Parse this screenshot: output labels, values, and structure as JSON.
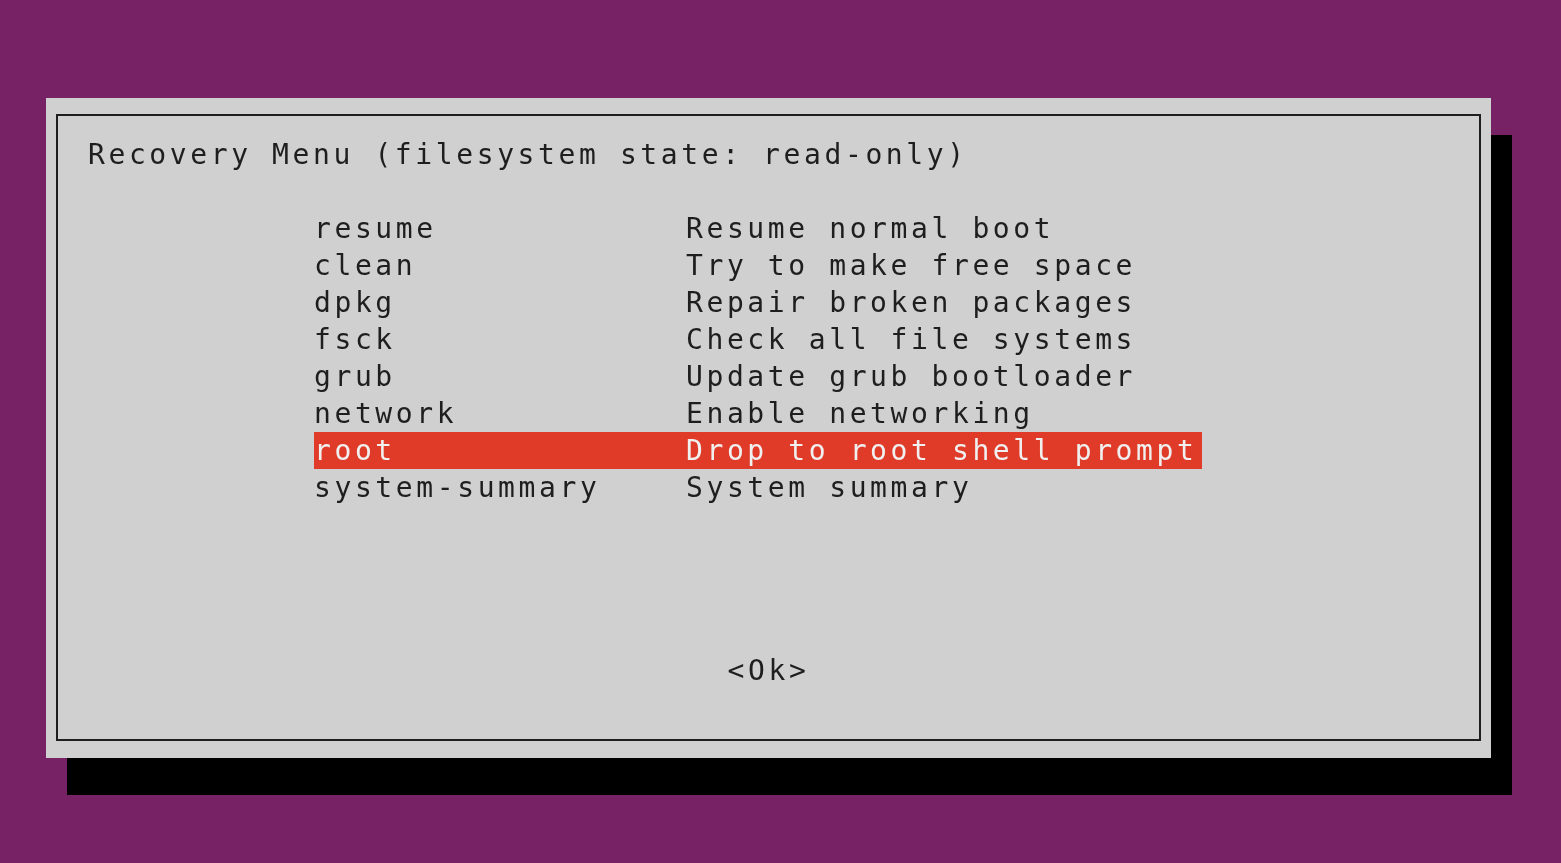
{
  "dialog": {
    "title": "Recovery Menu (filesystem state: read-only)",
    "items": [
      {
        "tag": "resume",
        "description": "Resume normal boot",
        "selected": false
      },
      {
        "tag": "clean",
        "description": "Try to make free space",
        "selected": false
      },
      {
        "tag": "dpkg",
        "description": "Repair broken packages",
        "selected": false
      },
      {
        "tag": "fsck",
        "description": "Check all file systems",
        "selected": false
      },
      {
        "tag": "grub",
        "description": "Update grub bootloader",
        "selected": false
      },
      {
        "tag": "network",
        "description": "Enable networking",
        "selected": false
      },
      {
        "tag": "root",
        "description": "Drop to root shell prompt",
        "selected": true
      },
      {
        "tag": "system-summary",
        "description": "System summary",
        "selected": false
      }
    ],
    "button": {
      "label": "<Ok>"
    }
  }
}
